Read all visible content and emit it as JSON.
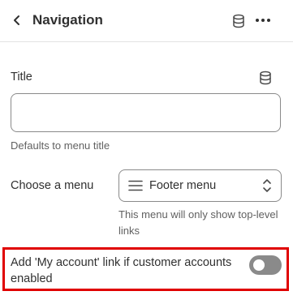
{
  "header": {
    "title": "Navigation",
    "back_icon": "chevron-left-icon",
    "db_icon": "database-icon",
    "more_icon": "more-horizontal-icon"
  },
  "title_field": {
    "label": "Title",
    "value": "",
    "help": "Defaults to menu title",
    "icon": "database-icon"
  },
  "menu_field": {
    "label": "Choose a menu",
    "value": "Footer menu",
    "help": "This menu will only show top-level links",
    "icon": "menu-lines-icon"
  },
  "account_toggle": {
    "label": "Add 'My account' link if customer accounts enabled",
    "checked": false
  },
  "colors": {
    "highlight": "#e00000",
    "toggle_off": "#8a8a8a",
    "text": "#303030",
    "muted": "#616161"
  }
}
